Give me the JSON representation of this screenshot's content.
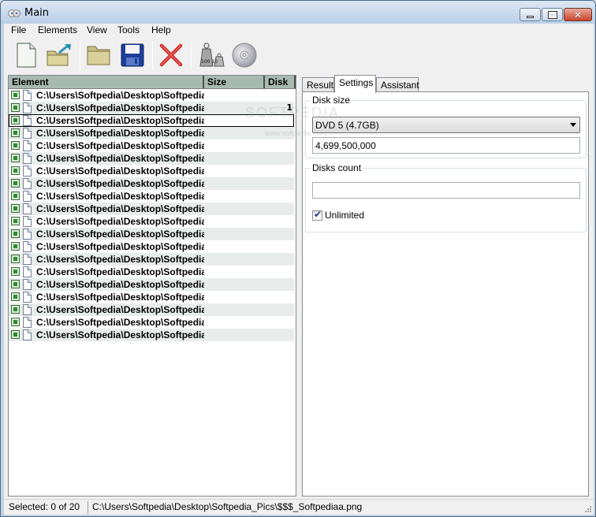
{
  "window": {
    "title": "Main"
  },
  "menu": [
    "File",
    "Elements",
    "View",
    "Tools",
    "Help"
  ],
  "toolbar": {
    "buttons": [
      "new-icon",
      "export-icon",
      "open-folder-icon",
      "save-icon",
      "delete-icon",
      "weights-icon",
      "disc-icon"
    ],
    "weights_label": "100 10"
  },
  "list": {
    "columns": [
      "Element",
      "Size",
      "Disk"
    ],
    "rows": [
      {
        "path": "C:\\Users\\Softpedia\\Desktop\\Softpedia_Pics\\$$$_Softpediaa.png",
        "disk": ""
      },
      {
        "path": "C:\\Users\\Softpedia\\Desktop\\Softpedia_Pics\\$$$_Softpediaa.png",
        "disk": "1"
      },
      {
        "path": "C:\\Users\\Softpedia\\Desktop\\Softpedia_Pics\\$$$_Softpediaa.png",
        "disk": ""
      },
      {
        "path": "C:\\Users\\Softpedia\\Desktop\\Softpedia_Pics\\$$$_Softpediaa.png",
        "disk": ""
      },
      {
        "path": "C:\\Users\\Softpedia\\Desktop\\Softpedia_Pics\\$$$_Softpediaa.png",
        "disk": ""
      },
      {
        "path": "C:\\Users\\Softpedia\\Desktop\\Softpedia_Pics\\$$$_Softpediaa.png",
        "disk": ""
      },
      {
        "path": "C:\\Users\\Softpedia\\Desktop\\Softpedia_Pics\\$$$_Softpediaa.png",
        "disk": ""
      },
      {
        "path": "C:\\Users\\Softpedia\\Desktop\\Softpedia_Pics\\$$$_Softpediaa.png",
        "disk": ""
      },
      {
        "path": "C:\\Users\\Softpedia\\Desktop\\Softpedia_Pics\\$$$_Softpediaa.png",
        "disk": ""
      },
      {
        "path": "C:\\Users\\Softpedia\\Desktop\\Softpedia_Pics\\$$$_Softpediaa.png",
        "disk": ""
      },
      {
        "path": "C:\\Users\\Softpedia\\Desktop\\Softpedia_Pics\\$$$_Softpediaa.png",
        "disk": ""
      },
      {
        "path": "C:\\Users\\Softpedia\\Desktop\\Softpedia_Pics\\$$$_Softpediaa.png",
        "disk": ""
      },
      {
        "path": "C:\\Users\\Softpedia\\Desktop\\Softpedia_Pics\\$$$_Softpediaa.png",
        "disk": ""
      },
      {
        "path": "C:\\Users\\Softpedia\\Desktop\\Softpedia_Pics\\$$$_Softpediaa.png",
        "disk": ""
      },
      {
        "path": "C:\\Users\\Softpedia\\Desktop\\Softpedia_Pics\\$$$_Softpediaa.png",
        "disk": ""
      },
      {
        "path": "C:\\Users\\Softpedia\\Desktop\\Softpedia_Pics\\$$$_Softpediaa.png",
        "disk": ""
      },
      {
        "path": "C:\\Users\\Softpedia\\Desktop\\Softpedia_Pics\\$$$_Softpediaa.png",
        "disk": ""
      },
      {
        "path": "C:\\Users\\Softpedia\\Desktop\\Softpedia_Pics\\$$$_Softpediaa.png",
        "disk": ""
      },
      {
        "path": "C:\\Users\\Softpedia\\Desktop\\Softpedia_Pics\\$$$_Softpediaa.png",
        "disk": ""
      },
      {
        "path": "C:\\Users\\Softpedia\\Desktop\\Softpedia_Pics\\$$$_Softpediaa.png",
        "disk": ""
      }
    ]
  },
  "tabs": [
    "Result",
    "Settings",
    "Assistant"
  ],
  "settings": {
    "disk_size_label": "Disk size",
    "disk_size_selected": "DVD 5 (4.7GB)",
    "disk_size_bytes": "4,699,500,000",
    "disks_count_label": "Disks count",
    "disks_count_value": "",
    "unlimited_label": "Unlimited",
    "unlimited_checked": true
  },
  "status": {
    "selected": "Selected: 0 of 20",
    "current_file": "C:\\Users\\Softpedia\\Desktop\\Softpedia_Pics\\$$$_Softpediaa.png"
  },
  "watermark": {
    "text": "SOFTPEDIA",
    "url": "www.softpedia.com"
  }
}
